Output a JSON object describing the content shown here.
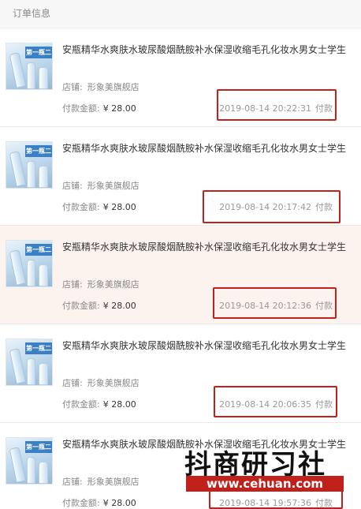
{
  "header": {
    "title": "订单信息"
  },
  "labels": {
    "shop_prefix": "店铺:",
    "amount_prefix": "付款金额:",
    "paid_suffix": "付款"
  },
  "thumbnail": {
    "banner": "第一瓶二"
  },
  "orders": [
    {
      "title": "安瓶精华水爽肤水玻尿酸烟酰胺补水保湿收缩毛孔化妆水男女士学生",
      "shop": "形象美旗舰店",
      "amount": "¥ 28.00",
      "time": "2019-08-14 20:22:31",
      "highlighted": false
    },
    {
      "title": "安瓶精华水爽肤水玻尿酸烟酰胺补水保湿收缩毛孔化妆水男女士学生",
      "shop": "形象美旗舰店",
      "amount": "¥ 28.00",
      "time": "2019-08-14 20:17:42",
      "highlighted": false
    },
    {
      "title": "安瓶精华水爽肤水玻尿酸烟酰胺补水保湿收缩毛孔化妆水男女士学生",
      "shop": "形象美旗舰店",
      "amount": "¥ 28.00",
      "time": "2019-08-14 20:12:36",
      "highlighted": true
    },
    {
      "title": "安瓶精华水爽肤水玻尿酸烟酰胺补水保湿收缩毛孔化妆水男女士学生",
      "shop": "形象美旗舰店",
      "amount": "¥ 28.00",
      "time": "2019-08-14 20:06:35",
      "highlighted": false
    },
    {
      "title": "安瓶精华水爽肤水玻尿酸烟酰胺补水保湿收缩毛孔化妆水男女士学生",
      "shop": "形象美旗舰店",
      "amount": "¥ 28.00",
      "time": "2019-08-14 19:57:36",
      "highlighted": false
    }
  ],
  "watermark": {
    "title": "抖商研习社",
    "url": "www.cehuan.com"
  },
  "colors": {
    "annotation_red": "#c0211b",
    "highlight_bg": "#fdf3ee"
  }
}
